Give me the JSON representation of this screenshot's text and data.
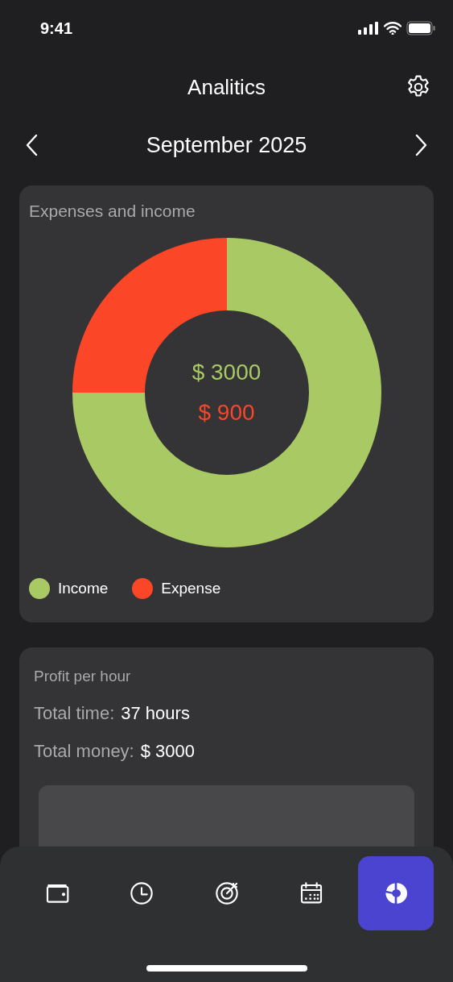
{
  "status_bar": {
    "time": "9:41"
  },
  "header": {
    "title": "Analitics"
  },
  "month_nav": {
    "label": "September 2025"
  },
  "expenses_card": {
    "title": "Expenses and income",
    "center_values": [
      {
        "text": "$ 3000",
        "color": "#a8c964"
      },
      {
        "text": "$ 900",
        "color": "#fc4628"
      }
    ],
    "chart_data": {
      "type": "donut",
      "categories": [
        "Income",
        "Expense"
      ],
      "series": [
        {
          "values": [
            75,
            25
          ]
        }
      ]
    },
    "legend": [
      {
        "color": "#a8c964"
      },
      {
        "color": "#fc4628"
      }
    ]
  },
  "profit_card": {
    "title": "Profit per hour",
    "rows": [
      {
        "label": "Total time:",
        "value": "37 hours"
      },
      {
        "label": "Total money:",
        "value": "$ 3000"
      }
    ]
  },
  "tab_bar": [
    {
      "kind": "wallet",
      "selected": false
    },
    {
      "kind": "clock",
      "selected": false
    },
    {
      "kind": "target",
      "selected": false
    },
    {
      "kind": "calendar",
      "selected": false
    },
    {
      "kind": "chart",
      "selected": true
    }
  ]
}
